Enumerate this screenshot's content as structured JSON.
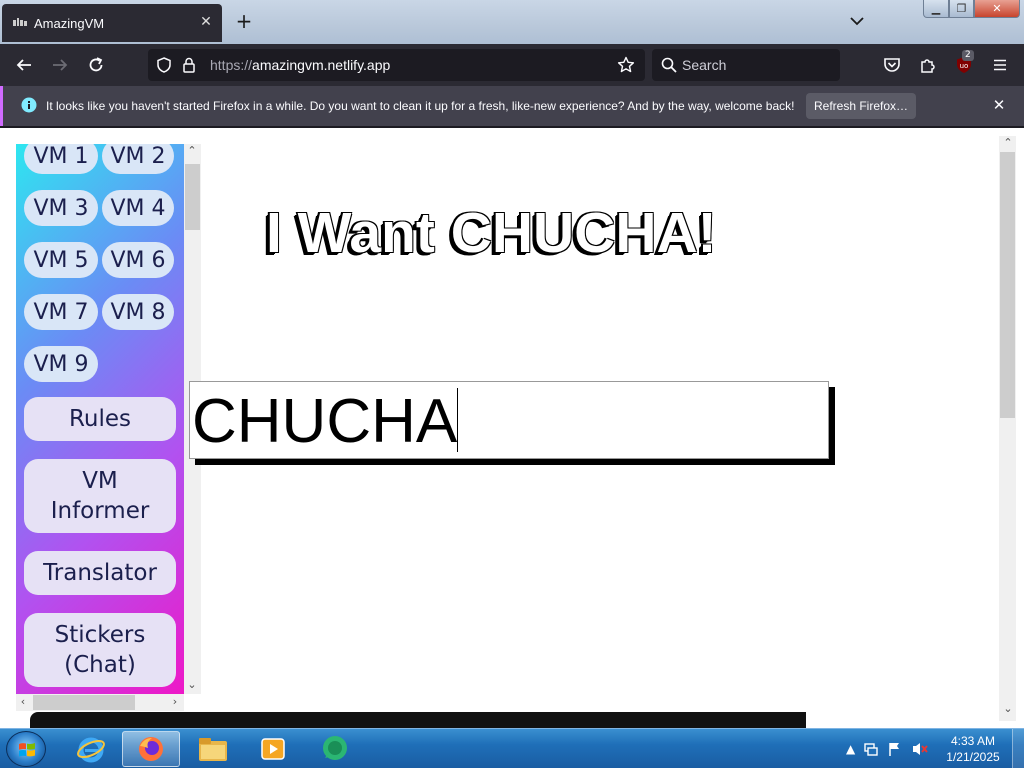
{
  "browser": {
    "tab_title": "AmazingVM",
    "tab_favicon": "vm-icon",
    "url_prefix": "https://",
    "url_host": "amazingvm.netlify.app",
    "search_placeholder": "Search",
    "extension_badge": "2"
  },
  "notification": {
    "text": "It looks like you haven't started Firefox in a while. Do you want to clean it up for a fresh, like-new experience? And by the way, welcome back!",
    "button": "Refresh Firefox…"
  },
  "sidebar": {
    "vms": [
      "VM 1",
      "VM 2",
      "VM 3",
      "VM 4",
      "VM 5",
      "VM 6",
      "VM 7",
      "VM 8",
      "VM 9"
    ],
    "buttons": [
      "Rules",
      "VM\nInformer",
      "Translator",
      "Stickers\n(Chat)"
    ]
  },
  "main": {
    "headline": "I Want CHUCHA!",
    "input_value": "CHUCHA"
  },
  "taskbar": {
    "apps": [
      "internet-explorer-icon",
      "firefox-icon",
      "file-explorer-icon",
      "media-player-icon",
      "chat-app-icon"
    ],
    "time": "4:33 AM",
    "date": "1/21/2025"
  },
  "colors": {
    "sidebar_gradient": [
      "#2ee6f0",
      "#6a8cf5",
      "#b152f0",
      "#ee18c7"
    ],
    "browser_dark": "#2b2a33",
    "notification_accent": "#d06bff",
    "taskbar": "#1f6fb8"
  }
}
